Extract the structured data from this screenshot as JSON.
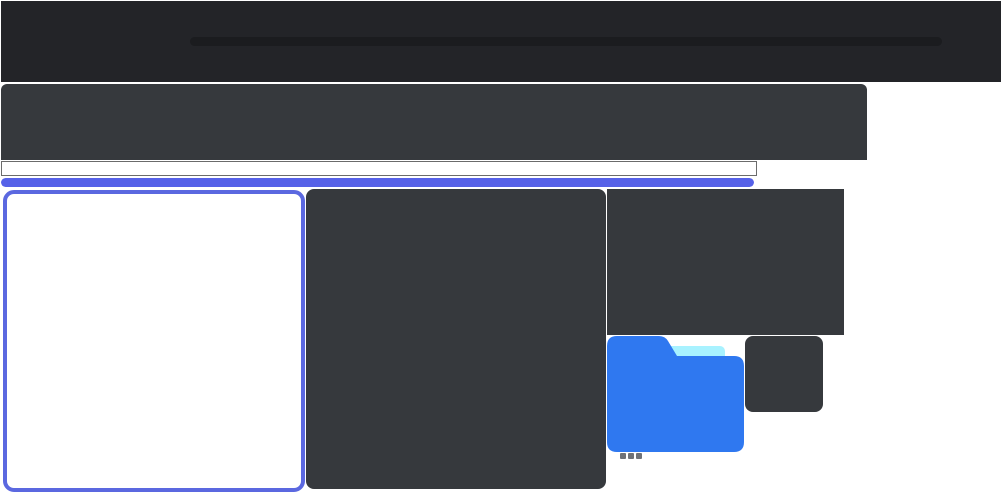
{
  "colors": {
    "topbar": "#232428",
    "search": "#1b1c1f",
    "panel": "#36393d",
    "accent": "#5661e8",
    "selection_border": "#5b68e0",
    "folder_front": "#2f78f0",
    "folder_back": "#a8f2ff",
    "dots": "#6f7278"
  },
  "progress": {
    "fraction": 1.0
  },
  "icons": {
    "folder": "folder-icon",
    "more": "more-dots-icon"
  }
}
